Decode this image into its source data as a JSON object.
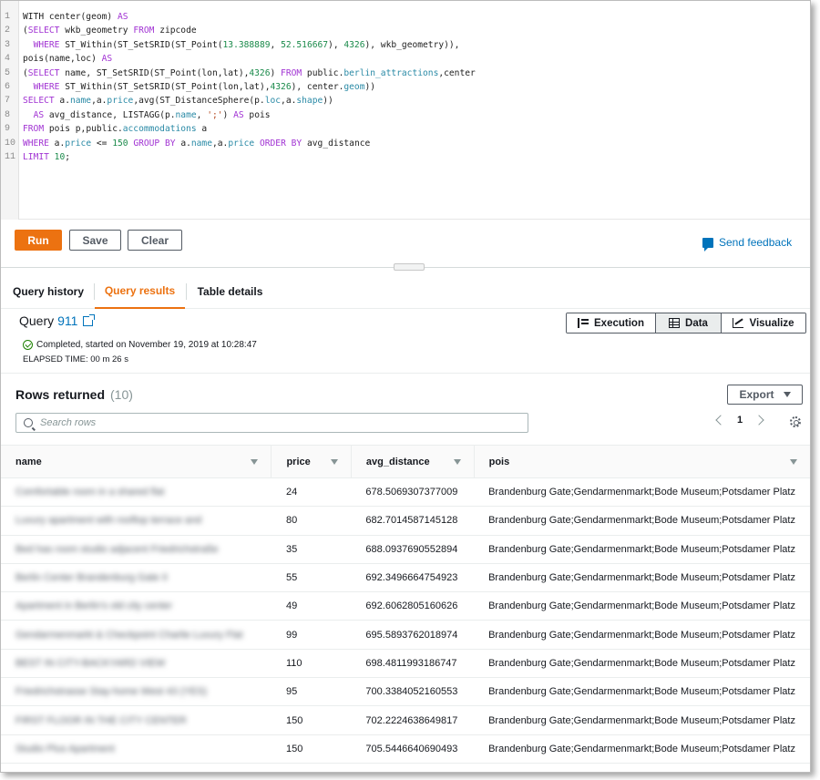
{
  "editor": {
    "line_numbers": [
      "1",
      "2",
      "3",
      "4",
      "5",
      "6",
      "7",
      "8",
      "9",
      "10",
      "11"
    ],
    "lines": [
      [
        {
          "t": "WITH center(geom) ",
          "c": ""
        },
        {
          "t": "AS",
          "c": "kw"
        }
      ],
      [
        {
          "t": "(",
          "c": ""
        },
        {
          "t": "SELECT",
          "c": "kw"
        },
        {
          "t": " wkb_geometry ",
          "c": ""
        },
        {
          "t": "FROM",
          "c": "kw"
        },
        {
          "t": " zipcode",
          "c": ""
        }
      ],
      [
        {
          "t": "  ",
          "c": ""
        },
        {
          "t": "WHERE",
          "c": "kw"
        },
        {
          "t": " ST_Within(ST_SetSRID(ST_Point(",
          "c": ""
        },
        {
          "t": "13.388889",
          "c": "num"
        },
        {
          "t": ", ",
          "c": ""
        },
        {
          "t": "52.516667",
          "c": "num"
        },
        {
          "t": "), ",
          "c": ""
        },
        {
          "t": "4326",
          "c": "num"
        },
        {
          "t": "), wkb_geometry)),",
          "c": ""
        }
      ],
      [
        {
          "t": "pois(name,loc) ",
          "c": ""
        },
        {
          "t": "AS",
          "c": "kw"
        }
      ],
      [
        {
          "t": "(",
          "c": ""
        },
        {
          "t": "SELECT",
          "c": "kw"
        },
        {
          "t": " name, ST_SetSRID(ST_Point(lon,lat),",
          "c": ""
        },
        {
          "t": "4326",
          "c": "num"
        },
        {
          "t": ") ",
          "c": ""
        },
        {
          "t": "FROM",
          "c": "kw"
        },
        {
          "t": " public.",
          "c": ""
        },
        {
          "t": "berlin_attractions",
          "c": "tbl"
        },
        {
          "t": ",center",
          "c": ""
        }
      ],
      [
        {
          "t": "  ",
          "c": ""
        },
        {
          "t": "WHERE",
          "c": "kw"
        },
        {
          "t": " ST_Within(ST_SetSRID(ST_Point(lon,lat),",
          "c": ""
        },
        {
          "t": "4326",
          "c": "num"
        },
        {
          "t": "), center.",
          "c": ""
        },
        {
          "t": "geom",
          "c": "tbl"
        },
        {
          "t": "))",
          "c": ""
        }
      ],
      [
        {
          "t": "SELECT",
          "c": "kw"
        },
        {
          "t": " a.",
          "c": ""
        },
        {
          "t": "name",
          "c": "tbl"
        },
        {
          "t": ",a.",
          "c": ""
        },
        {
          "t": "price",
          "c": "tbl"
        },
        {
          "t": ",avg(ST_DistanceSphere(p.",
          "c": ""
        },
        {
          "t": "loc",
          "c": "tbl"
        },
        {
          "t": ",a.",
          "c": ""
        },
        {
          "t": "shape",
          "c": "tbl"
        },
        {
          "t": "))",
          "c": ""
        }
      ],
      [
        {
          "t": "  ",
          "c": ""
        },
        {
          "t": "AS",
          "c": "kw"
        },
        {
          "t": " avg_distance, LISTAGG(p.",
          "c": ""
        },
        {
          "t": "name",
          "c": "tbl"
        },
        {
          "t": ", ",
          "c": ""
        },
        {
          "t": "';'",
          "c": "str"
        },
        {
          "t": ") ",
          "c": ""
        },
        {
          "t": "AS",
          "c": "kw"
        },
        {
          "t": " pois",
          "c": ""
        }
      ],
      [
        {
          "t": "FROM",
          "c": "kw"
        },
        {
          "t": " pois p,public.",
          "c": ""
        },
        {
          "t": "accommodations",
          "c": "tbl"
        },
        {
          "t": " a",
          "c": ""
        }
      ],
      [
        {
          "t": "WHERE",
          "c": "kw"
        },
        {
          "t": " a.",
          "c": ""
        },
        {
          "t": "price",
          "c": "tbl"
        },
        {
          "t": " <= ",
          "c": ""
        },
        {
          "t": "150",
          "c": "num"
        },
        {
          "t": " ",
          "c": ""
        },
        {
          "t": "GROUP BY",
          "c": "kw"
        },
        {
          "t": " a.",
          "c": ""
        },
        {
          "t": "name",
          "c": "tbl"
        },
        {
          "t": ",a.",
          "c": ""
        },
        {
          "t": "price",
          "c": "tbl"
        },
        {
          "t": " ",
          "c": ""
        },
        {
          "t": "ORDER BY",
          "c": "kw"
        },
        {
          "t": " avg_distance",
          "c": ""
        }
      ],
      [
        {
          "t": "LIMIT",
          "c": "kw"
        },
        {
          "t": " ",
          "c": ""
        },
        {
          "t": "10",
          "c": "num"
        },
        {
          "t": ";",
          "c": ""
        }
      ]
    ]
  },
  "toolbar": {
    "run_label": "Run",
    "save_label": "Save",
    "clear_label": "Clear",
    "feedback_label": "Send feedback"
  },
  "tabs": {
    "history": "Query history",
    "results": "Query results",
    "details": "Table details"
  },
  "query": {
    "label": "Query",
    "id": "911",
    "status": "Completed, started on November 19, 2019 at 10:28:47",
    "elapsed": "ELAPSED TIME: 00 m 26 s"
  },
  "view_toggle": {
    "execution": "Execution",
    "data": "Data",
    "visualize": "Visualize"
  },
  "results": {
    "title": "Rows returned",
    "count": "(10)",
    "export_label": "Export",
    "search_placeholder": "Search rows",
    "page": "1",
    "columns": [
      "name",
      "price",
      "avg_distance",
      "pois"
    ],
    "rows": [
      [
        "Comfortable room in a shared flat",
        "24",
        "678.5069307377009",
        "Brandenburg Gate;Gendarmenmarkt;Bode Museum;Potsdamer Platz"
      ],
      [
        "Luxury apartment with rooftop terrace and",
        "80",
        "682.7014587145128",
        "Brandenburg Gate;Gendarmenmarkt;Bode Museum;Potsdamer Platz"
      ],
      [
        "Bed has room studio adjacent Friedrichstraße",
        "35",
        "688.0937690552894",
        "Brandenburg Gate;Gendarmenmarkt;Bode Museum;Potsdamer Platz"
      ],
      [
        "Berlin Center Brandenburg Gate II",
        "55",
        "692.3496664754923",
        "Brandenburg Gate;Gendarmenmarkt;Bode Museum;Potsdamer Platz"
      ],
      [
        "Apartment in Berlin's old city center",
        "49",
        "692.6062805160626",
        "Brandenburg Gate;Gendarmenmarkt;Bode Museum;Potsdamer Platz"
      ],
      [
        "Gendarmenmarkt & Checkpoint Charlie Luxury Flat",
        "99",
        "695.5893762018974",
        "Brandenburg Gate;Gendarmenmarkt;Bode Museum;Potsdamer Platz"
      ],
      [
        "BEST IN CITY-BACKYARD VIEW",
        "110",
        "698.4811993186747",
        "Brandenburg Gate;Gendarmenmarkt;Bode Museum;Potsdamer Platz"
      ],
      [
        "Friedrichstrasse Stay-home West 43 (YES)",
        "95",
        "700.3384052160553",
        "Brandenburg Gate;Gendarmenmarkt;Bode Museum;Potsdamer Platz"
      ],
      [
        "FIRST FLOOR IN THE CITY CENTER",
        "150",
        "702.2224638649817",
        "Brandenburg Gate;Gendarmenmarkt;Bode Museum;Potsdamer Platz"
      ],
      [
        "Studio Plus Apartment",
        "150",
        "705.5446640690493",
        "Brandenburg Gate;Gendarmenmarkt;Bode Museum;Potsdamer Platz"
      ]
    ]
  },
  "colors": {
    "accent": "#ec7211",
    "link": "#0073bb",
    "success": "#1d8102"
  }
}
